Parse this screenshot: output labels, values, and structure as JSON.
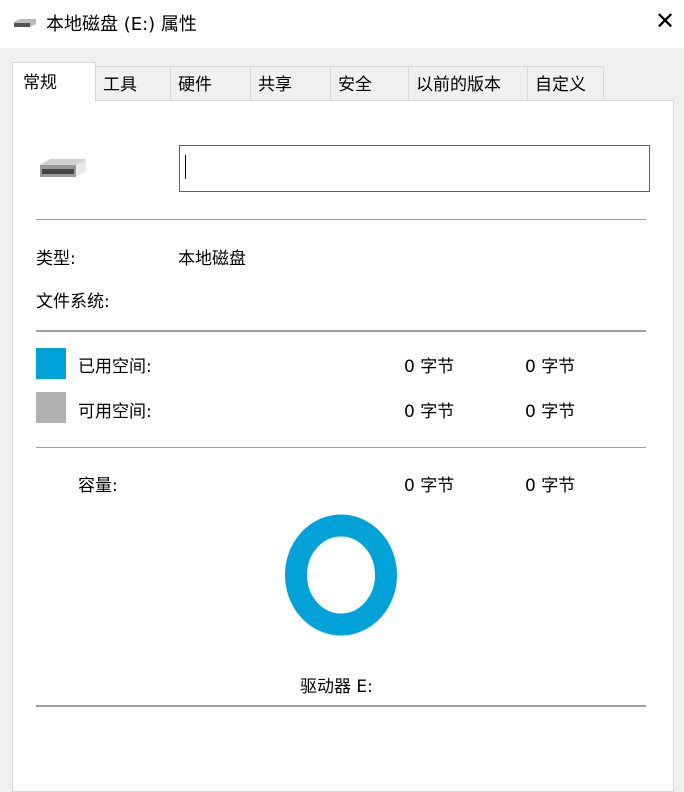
{
  "window": {
    "title": "本地磁盘 (E:) 属性",
    "close_label": "✕"
  },
  "tabs": [
    {
      "label": "常规",
      "active": true
    },
    {
      "label": "工具"
    },
    {
      "label": "硬件"
    },
    {
      "label": "共享"
    },
    {
      "label": "安全"
    },
    {
      "label": "以前的版本"
    },
    {
      "label": "自定义"
    }
  ],
  "general": {
    "name_value": "",
    "type_label": "类型:",
    "type_value": "本地磁盘",
    "fs_label": "文件系统:",
    "fs_value": "",
    "used": {
      "label": "已用空间:",
      "bytes": "0 字节",
      "size": "0 字节",
      "color": "#00a2d8"
    },
    "free": {
      "label": "可用空间:",
      "bytes": "0 字节",
      "size": "0 字节",
      "color": "#b0b0b0"
    },
    "capacity": {
      "label": "容量:",
      "bytes": "0 字节",
      "size": "0 字节"
    },
    "drive_label": "驱动器 E:",
    "used_fraction": 0
  }
}
